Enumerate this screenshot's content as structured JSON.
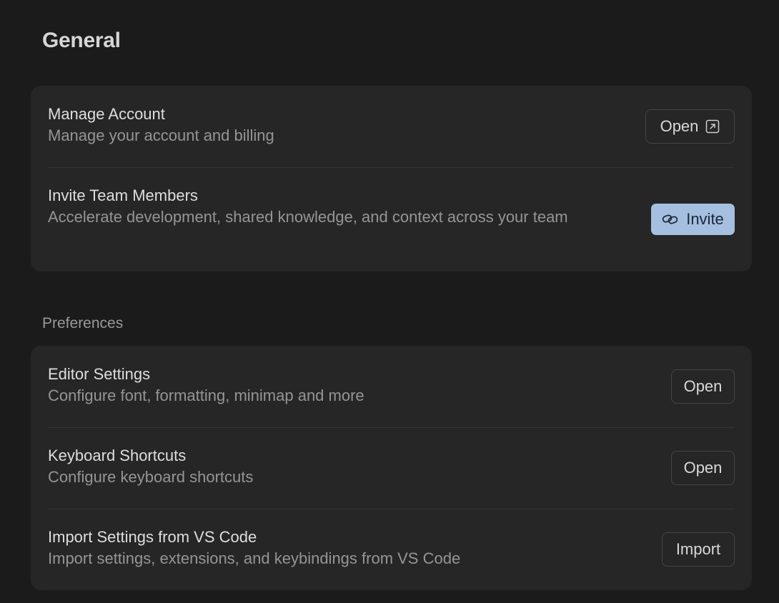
{
  "page": {
    "title": "General"
  },
  "general": {
    "rows": [
      {
        "title": "Manage Account",
        "description": "Manage your account and billing",
        "button": {
          "label": "Open",
          "icon": "external-link-icon"
        }
      },
      {
        "title": "Invite Team Members",
        "description": "Accelerate development, shared knowledge, and context across your team",
        "button": {
          "label": "Invite",
          "icon": "link-icon",
          "color": "#a4bfe0"
        }
      }
    ]
  },
  "preferences": {
    "label": "Preferences",
    "rows": [
      {
        "title": "Editor Settings",
        "description": "Configure font, formatting, minimap and more",
        "button": {
          "label": "Open"
        }
      },
      {
        "title": "Keyboard Shortcuts",
        "description": "Configure keyboard shortcuts",
        "button": {
          "label": "Open"
        }
      },
      {
        "title": "Import Settings from VS Code",
        "description": "Import settings, extensions, and keybindings from VS Code",
        "button": {
          "label": "Import"
        }
      }
    ]
  },
  "colors": {
    "background": "#1b1b1b",
    "card": "#262626",
    "accent": "#a4bfe0"
  }
}
